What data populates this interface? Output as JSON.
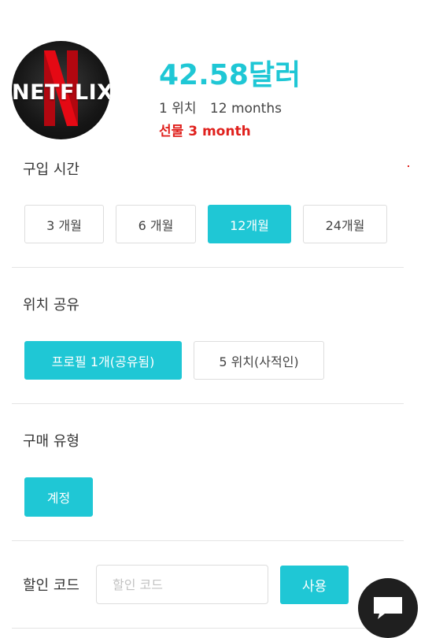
{
  "product": {
    "logo_text": "NETFLIX",
    "price": "42.58달러",
    "location_count": "1 위치",
    "duration": "12 months",
    "gift": "선물 3 month"
  },
  "purchase_time": {
    "title": "구입 시간",
    "options": [
      "3 개월",
      "6 개월",
      "12개월",
      "24개월"
    ],
    "selected": "12개월"
  },
  "location_share": {
    "title": "위치 공유",
    "options": [
      "프로필 1개(공유됨)",
      "5 위치(사적인)"
    ],
    "selected": "프로필 1개(공유됨)"
  },
  "purchase_type": {
    "title": "구매 유형",
    "options": [
      "계정"
    ],
    "selected": "계정"
  },
  "discount": {
    "label": "할인 코드",
    "placeholder": "할인 코드",
    "value": "",
    "apply_label": "사용"
  },
  "colors": {
    "accent": "#1fc7d5",
    "gift_red": "#e0211d",
    "netflix_red": "#e50914",
    "chat_bubble": "#1f1f1f"
  },
  "icons": {
    "chat": "chat-bubble-icon"
  }
}
